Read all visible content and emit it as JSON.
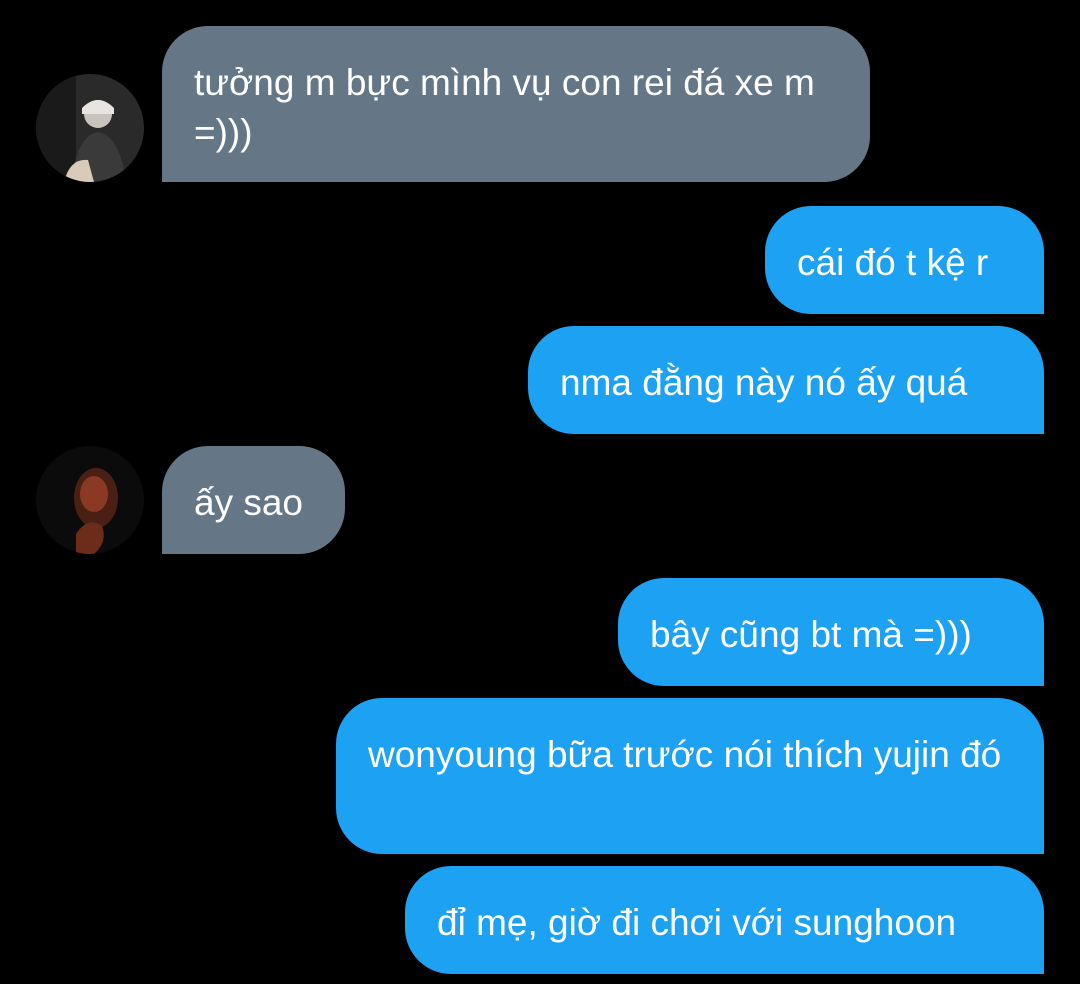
{
  "colors": {
    "background": "#000000",
    "incoming_bubble": "#657786",
    "outgoing_bubble": "#1da1f2",
    "text": "#ffffff"
  },
  "messages": [
    {
      "direction": "incoming",
      "text": "tưởng m bực mình vụ con rei đá xe m =)))",
      "avatar": "sender-avatar-icon"
    },
    {
      "direction": "outgoing",
      "text": "cái đó t kệ r"
    },
    {
      "direction": "outgoing",
      "text": "nma đằng này nó ấy quá"
    },
    {
      "direction": "incoming",
      "text": "ấy sao",
      "avatar": "sender-avatar-icon"
    },
    {
      "direction": "outgoing",
      "text": "bây cũng bt mà =)))"
    },
    {
      "direction": "outgoing",
      "text": "wonyoung bữa trước nói thích yujin đó"
    },
    {
      "direction": "outgoing",
      "text": "đỉ mẹ, giờ đi chơi với sunghoon"
    }
  ]
}
